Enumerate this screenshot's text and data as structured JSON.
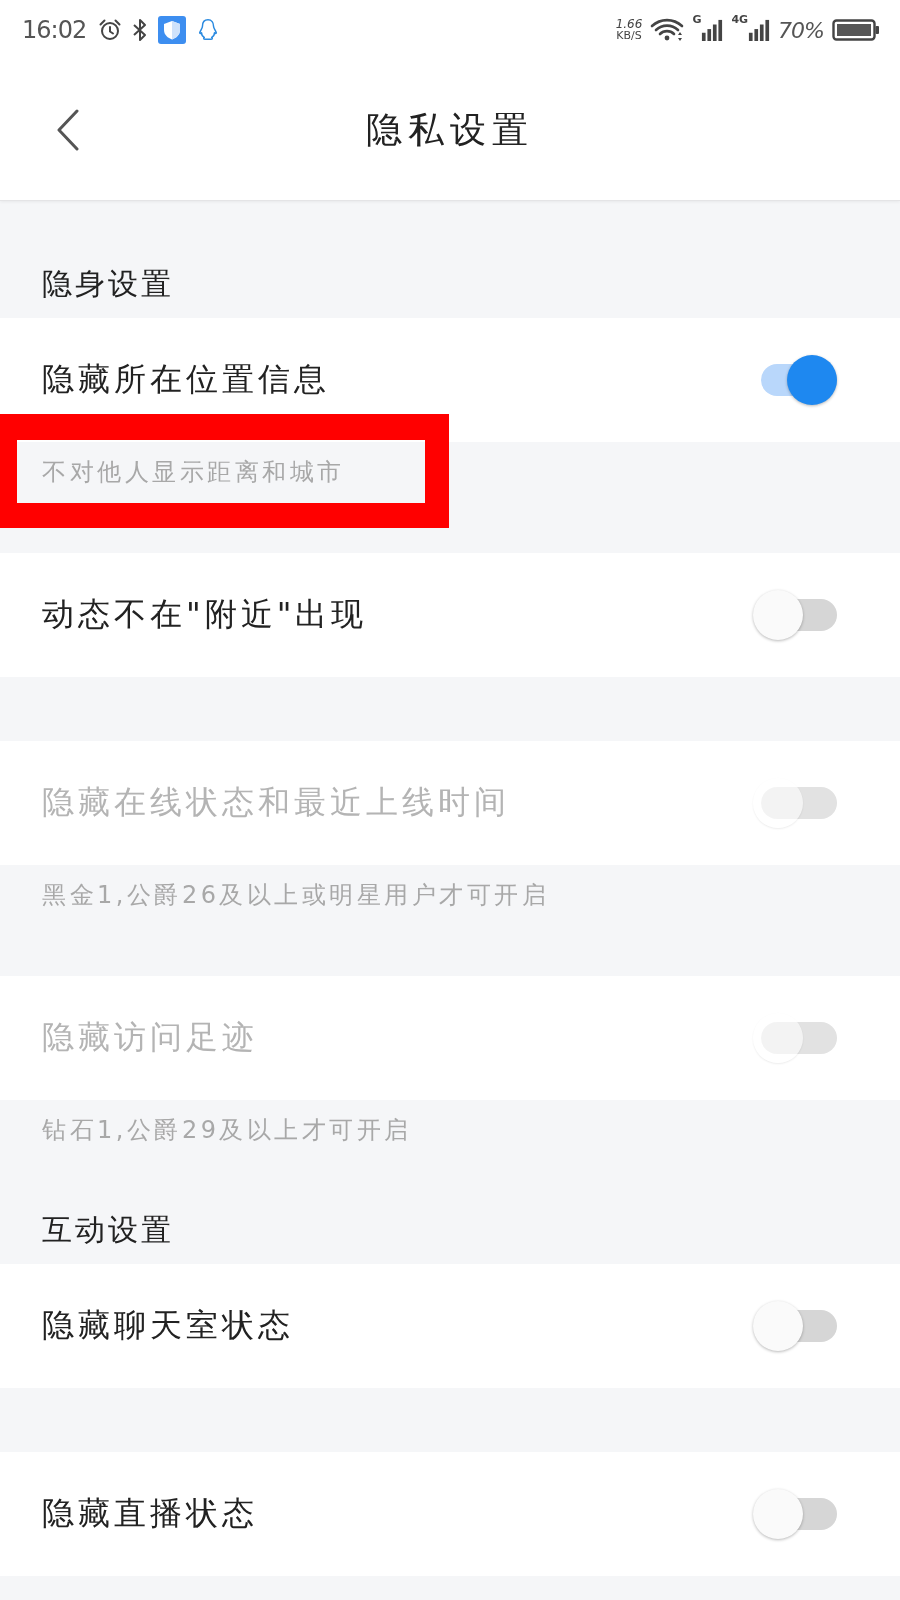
{
  "status_bar": {
    "time": "16:02",
    "speed_value": "1.66",
    "speed_unit": "KB/S",
    "signals": [
      {
        "label": "G"
      },
      {
        "label": "4G"
      }
    ],
    "battery": "70%"
  },
  "header": {
    "title": "隐私设置"
  },
  "sections": [
    {
      "title": "隐身设置",
      "items": [
        {
          "label": "隐藏所在位置信息",
          "on": true,
          "disabled": false,
          "note": {
            "text": "不对他人显示距离和城市",
            "highlighted": true
          }
        },
        {
          "label": "动态不在\"附近\"出现",
          "on": false,
          "disabled": false
        },
        {
          "label": "隐藏在线状态和最近上线时间",
          "on": false,
          "disabled": true,
          "note": {
            "text": "黑金1,公爵26及以上或明星用户才可开启",
            "highlighted": false
          }
        },
        {
          "label": "隐藏访问足迹",
          "on": false,
          "disabled": true,
          "note": {
            "text": "钻石1,公爵29及以上才可开启",
            "highlighted": false
          }
        }
      ]
    },
    {
      "title": "互动设置",
      "items": [
        {
          "label": "隐藏聊天室状态",
          "on": false,
          "disabled": false
        },
        {
          "label": "隐藏直播状态",
          "on": false,
          "disabled": false
        }
      ]
    }
  ]
}
